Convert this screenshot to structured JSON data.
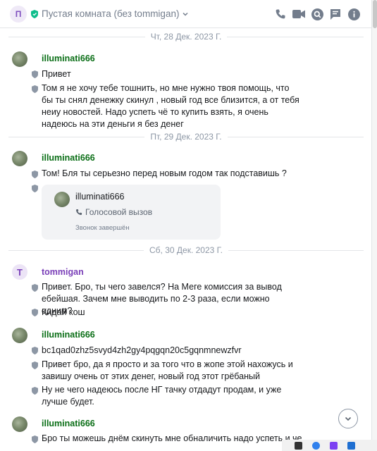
{
  "header": {
    "avatar_letter": "П",
    "room_name": "Пустая комната (без tommigan)",
    "icons": [
      "phone-icon",
      "video-icon",
      "search-icon",
      "threads-icon",
      "info-icon"
    ]
  },
  "dates": {
    "d1": "Чт, 28 Дек. 2023 Г.",
    "d2": "Пт, 29 Дек. 2023 Г.",
    "d3": "Сб, 30 Дек. 2023 Г."
  },
  "messages": {
    "g1": {
      "sender": "illuminati666",
      "m1": "Привет",
      "m2": "Том я не хочу тебе тошнить, но мне нужно твоя помощь, что бы ты снял денежку скинул , новый год все близится, а от тебя неиу новостей. Надо успеть чё то купить взять, я очень надеюсь на эти деньги я без денег"
    },
    "g2": {
      "sender": "illuminati666",
      "m1": "Том! Бля ты серьезно перед новым годом так подставишь ?"
    },
    "call": {
      "name": "illuminati666",
      "type": "Голосовой вызов",
      "status": "Звонок завершён"
    },
    "g3": {
      "avatar_letter": "T",
      "sender": "tommigan",
      "m1": "Привет. Бро, ты чего завелся? На Меге комиссия за вывод ебейшая. Зачем мне выводить по 2-3 раза, если можно одним?",
      "m2": "Кидай кош"
    },
    "g4": {
      "sender": "illuminati666",
      "m1": "bc1qad0zhz5svyd4zh2gy4pqgqn20c5gqnmnewzfvr",
      "m2": "Привет бро, да я просто и за того что в жопе этой нахожусь и завишу очень от этих денег, новый год этот грёбаный",
      "m3": "Ну не чего надеюсь после НГ тачку отдадут продам, и уже лучше будет."
    },
    "g5": {
      "sender": "illuminati666",
      "m1": "Бро ты можешь днём скинуть мне обналичить надо успеть и че то"
    }
  },
  "colors": {
    "accent_green": "#0a6e16",
    "accent_purple": "#7a3fb8",
    "muted": "#737d8c"
  }
}
